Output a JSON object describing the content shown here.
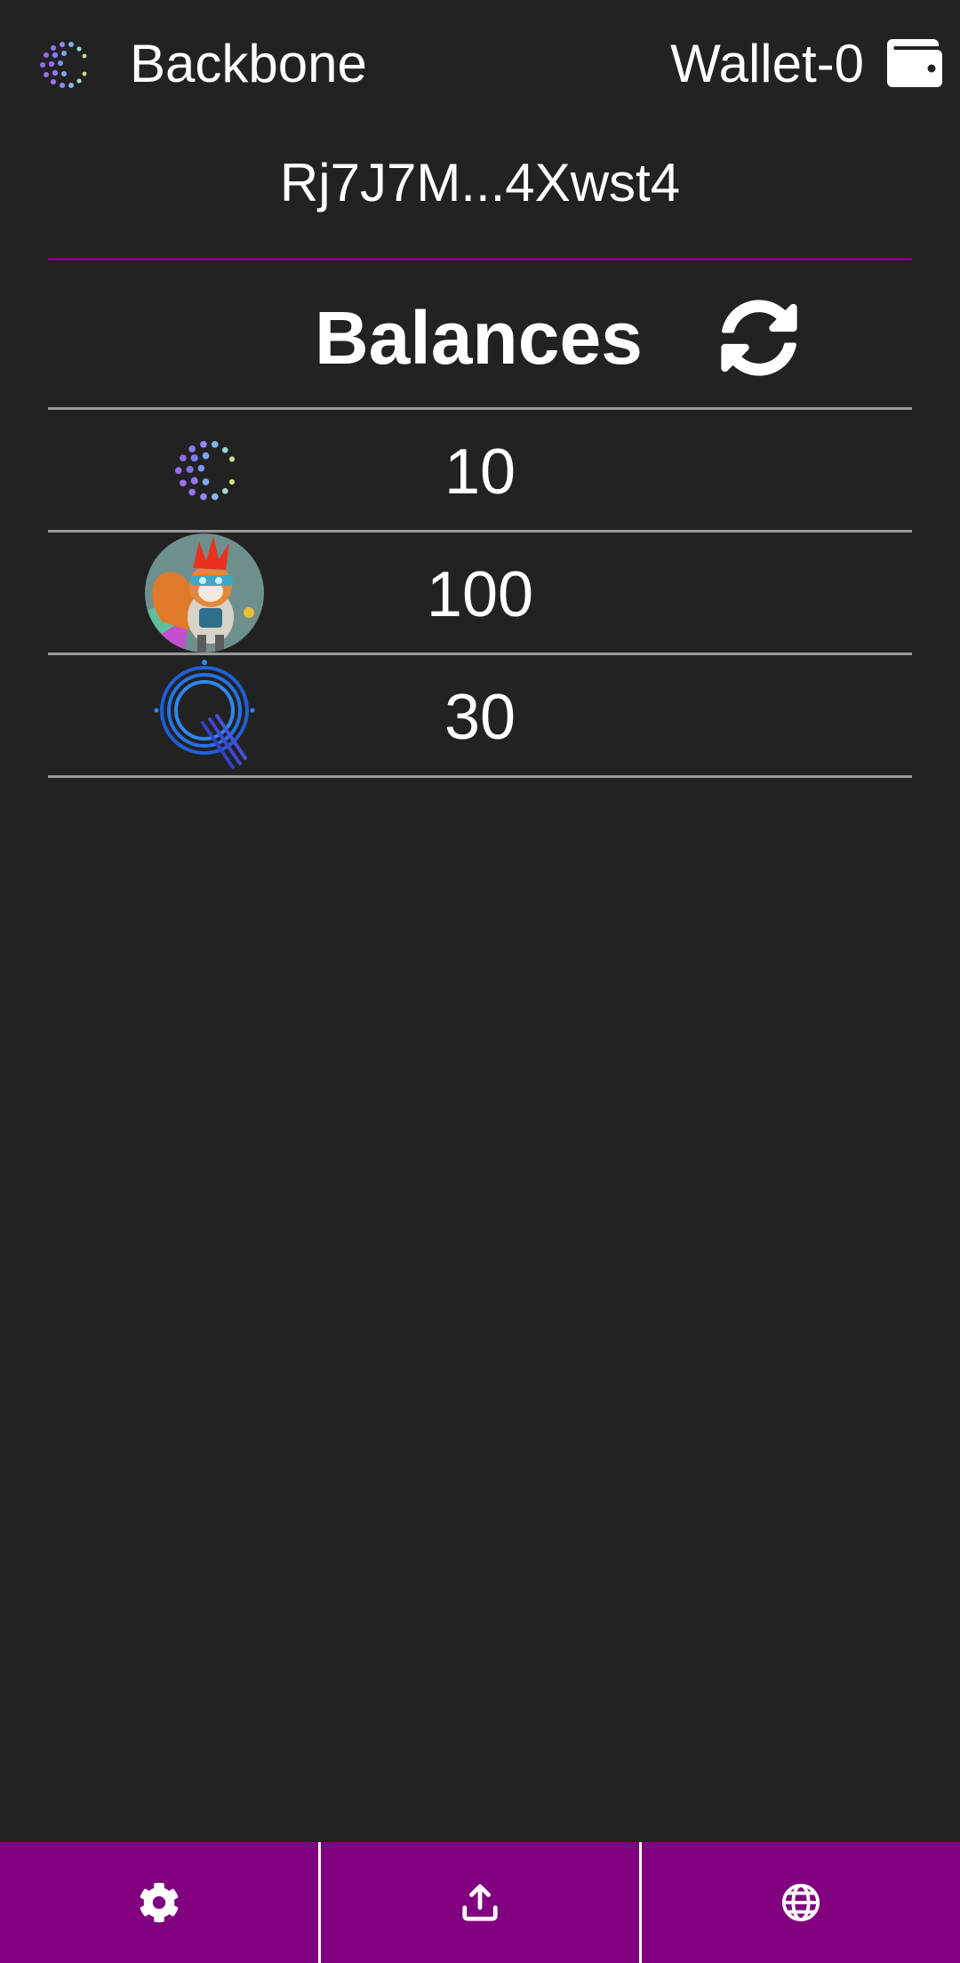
{
  "header": {
    "app_title": "Backbone",
    "app_logo_icon": "backbone-dots-logo-icon",
    "wallet_name": "Wallet-0",
    "wallet_icon": "wallet-icon"
  },
  "address": "Rj7J7M...4Xwst4",
  "balances": {
    "title": "Balances",
    "refresh_icon": "refresh-icon",
    "rows": [
      {
        "token_icon": "backbone-dots-logo-icon",
        "amount": "10"
      },
      {
        "token_icon": "squirrel-avatar-token-icon",
        "amount": "100"
      },
      {
        "token_icon": "blue-q-token-icon",
        "amount": "30"
      }
    ]
  },
  "bottom_nav": {
    "items": [
      {
        "icon": "gear-icon"
      },
      {
        "icon": "upload-icon"
      },
      {
        "icon": "globe-icon"
      }
    ]
  },
  "colors": {
    "background": "#222222",
    "accent": "#800080",
    "divider": "#9a9a9a",
    "text": "#ffffff"
  }
}
